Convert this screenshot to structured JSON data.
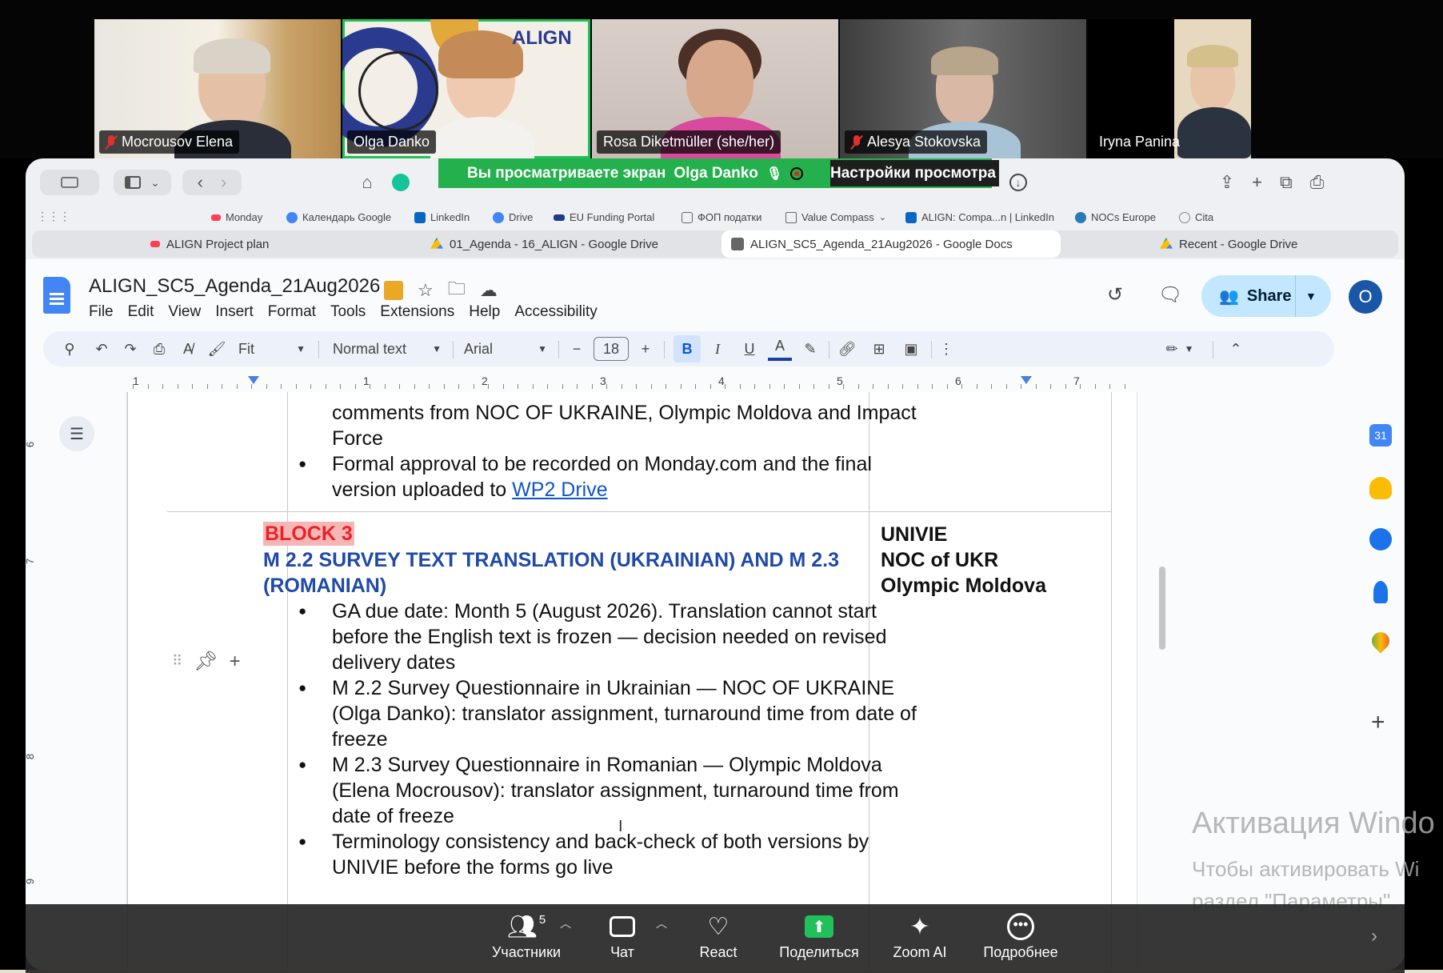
{
  "participants": [
    {
      "name": "Mocrousov Elena",
      "muted": true
    },
    {
      "name": "Olga Danko",
      "muted": false
    },
    {
      "name": "Rosa Diketmüller (she/her)",
      "muted": false
    },
    {
      "name": "Alesya Stokovska",
      "muted": true
    },
    {
      "name": "Iryna Panina",
      "muted": false
    }
  ],
  "logo_text": "ALIGN",
  "share_banner": {
    "text": "Вы просматриваете экран",
    "presenter": "Olga Danko",
    "view_settings": "Настройки просмотра"
  },
  "bookmarks": [
    "Monday",
    "Календарь Google",
    "LinkedIn",
    "Drive",
    "EU Funding Portal",
    "ФОП податки",
    "Value Compass",
    "ALIGN: Compa...n | LinkedIn",
    "NOCs Europe",
    "Cita"
  ],
  "tabs": [
    "ALIGN Project plan",
    "01_Agenda - 16_ALIGN - Google Drive",
    "ALIGN_SC5_Agenda_21Aug2026 - Google Docs",
    "Recent - Google Drive"
  ],
  "doc": {
    "title": "ALIGN_SC5_Agenda_21Aug2026",
    "menu": [
      "File",
      "Edit",
      "View",
      "Insert",
      "Format",
      "Tools",
      "Extensions",
      "Help",
      "Accessibility"
    ],
    "share_label": "Share",
    "avatar_letter": "O",
    "toolbar": {
      "zoom": "Fit",
      "style": "Normal text",
      "font": "Arial",
      "font_size": "18"
    },
    "ruler": [
      "1",
      "1",
      "2",
      "3",
      "4",
      "5",
      "6",
      "7"
    ],
    "vruler": [
      "6",
      "7",
      "8",
      "9"
    ]
  },
  "content": {
    "prev_line1": "comments from NOC OF UKRAINE, Olympic Moldova and Impact",
    "prev_line2": "Force",
    "prev_bullet_a": "Formal approval to be recorded on Monday.com and the final",
    "prev_bullet_b": "version uploaded to ",
    "prev_link": "WP2 Drive",
    "block_tag": "BLOCK 3",
    "heading_1": "M 2.2 SURVEY TEXT  TRANSLATION (UKRAINIAN) AND M 2.3",
    "heading_2": "(ROMANIAN)",
    "bullets": [
      [
        "GA due date: Month 5 (August 2026). Translation cannot start",
        "before the English text is frozen — decision needed on revised",
        "delivery dates"
      ],
      [
        "M 2.2 Survey Questionnaire in Ukrainian — NOC OF UKRAINE",
        "(Olga Danko): translator assignment, turnaround time from date of",
        "freeze"
      ],
      [
        "M 2.3 Survey Questionnaire in Romanian — Olympic Moldova",
        "(Elena Mocrousov): translator assignment, turnaround time from",
        "date of freeze"
      ],
      [
        "Terminology consistency and back-check of both versions by",
        "UNIVIE before the forms go live"
      ]
    ],
    "responsible": [
      "UNIVIE",
      "NOC of UKR",
      "Olympic Moldova"
    ]
  },
  "watermark": {
    "line1": "Активация Windo",
    "line2": "Чтобы активировать Wi",
    "line3": "раздел \"Параметры\"."
  },
  "zoom_toolbar": {
    "participants": "Участники",
    "participants_count": "5",
    "chat": "Чат",
    "react": "React",
    "share": "Поделиться",
    "ai": "Zoom AI",
    "more": "Подробнее"
  }
}
